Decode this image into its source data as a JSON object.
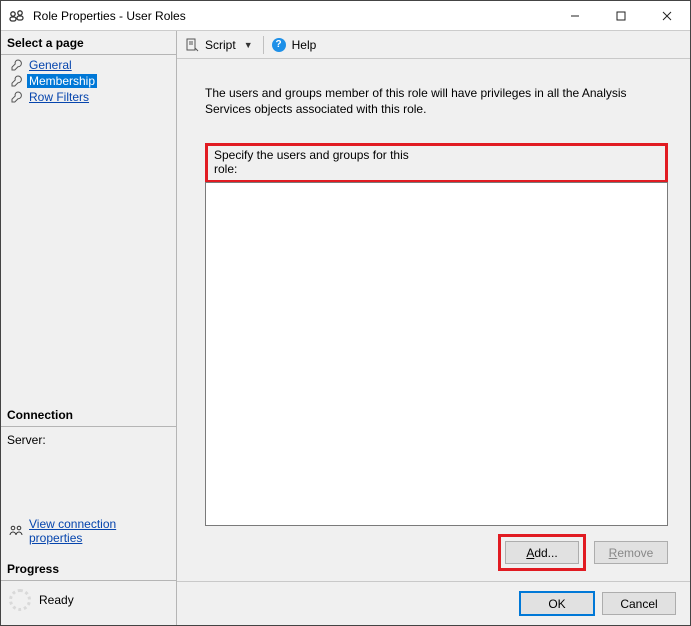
{
  "window": {
    "title": "Role Properties - User Roles"
  },
  "sidebar": {
    "select_page_header": "Select a page",
    "pages": [
      {
        "label": "General",
        "selected": false
      },
      {
        "label": "Membership",
        "selected": true
      },
      {
        "label": "Row Filters",
        "selected": false
      }
    ],
    "connection_header": "Connection",
    "server_label": "Server:",
    "view_conn_link": "View connection properties",
    "progress_header": "Progress",
    "progress_status": "Ready"
  },
  "toolbar": {
    "script_label": "Script",
    "help_label": "Help"
  },
  "content": {
    "description": "The users and groups member of this role will have privileges in all the Analysis Services objects associated with this role.",
    "specify_label": "Specify the users and groups for this role:",
    "add_label": "Add...",
    "remove_label": "Remove"
  },
  "footer": {
    "ok_label": "OK",
    "cancel_label": "Cancel"
  }
}
